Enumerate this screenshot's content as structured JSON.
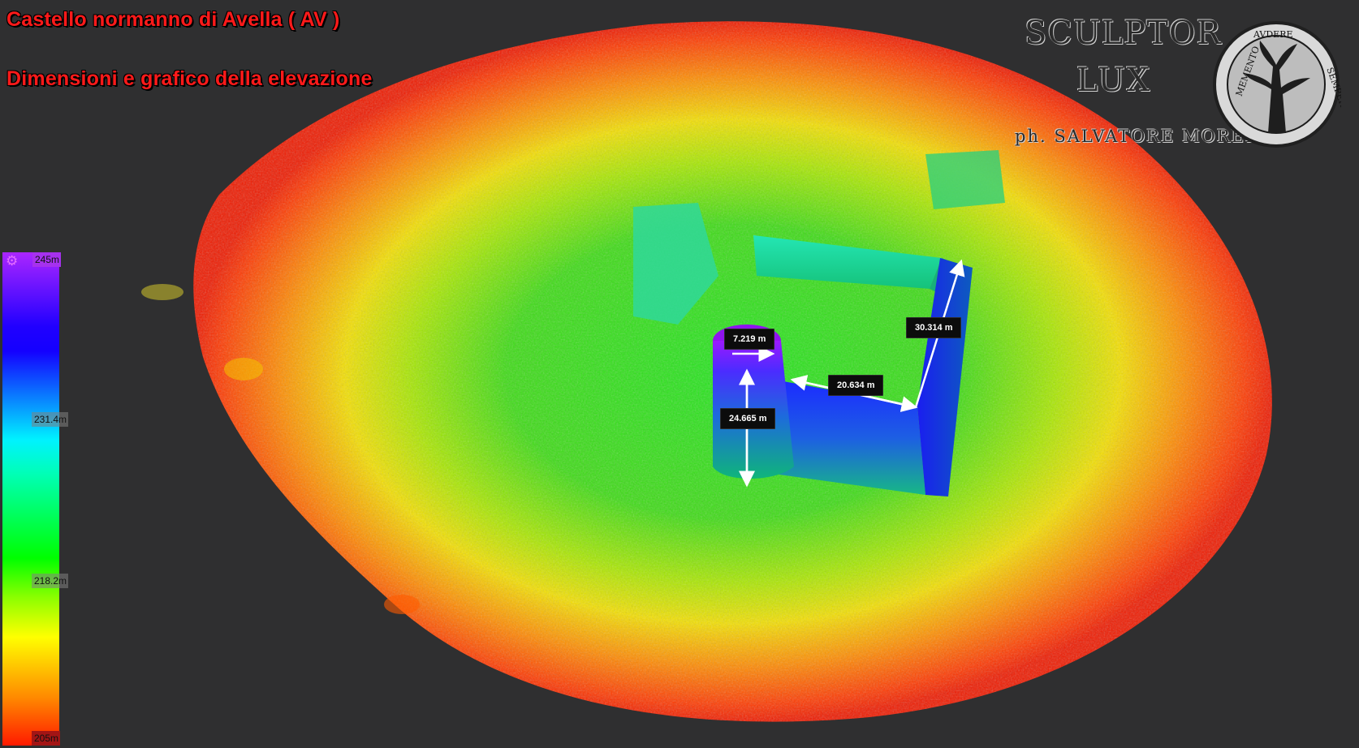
{
  "overlay": {
    "title_line1": "Castello normanno di Avella ( AV )",
    "title_line2": "Dimensioni e grafico della elevazione",
    "brand_line1": "SCULPTOR",
    "brand_line2": "LUX",
    "brand_credit": "ph. SALVATORE MORELLI",
    "seal_text_left": "MEMENTO",
    "seal_text_mid": "AVDERE",
    "seal_text_right": "SEMPER"
  },
  "colorbar": {
    "ticks": [
      "245m",
      "231.4m",
      "218.2m",
      "205m"
    ],
    "stops": [
      "#ab26ff",
      "#2100ff",
      "#00f2ff",
      "#00ff00",
      "#ffff00",
      "#ff8c00",
      "#ff1a00"
    ],
    "settings_icon": "gear-icon"
  },
  "measurements": [
    {
      "label": "7.219 m"
    },
    {
      "label": "20.634 m"
    },
    {
      "label": "30.314 m"
    },
    {
      "label": "24.665 m"
    }
  ],
  "colors": {
    "background": "#2f2f30",
    "title": "#ff1a1a",
    "label_bg": "#0c0c0c"
  }
}
